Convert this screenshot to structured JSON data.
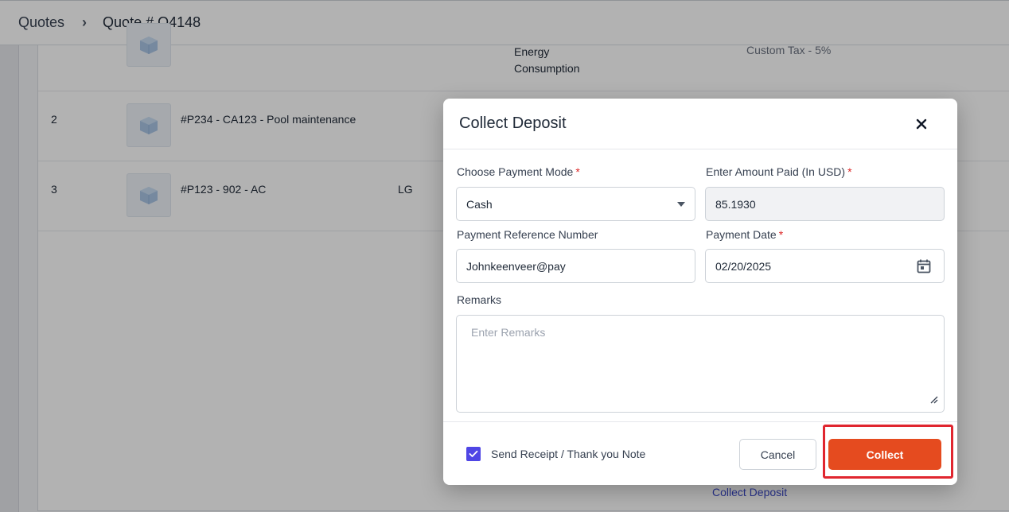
{
  "breadcrumb": {
    "parent": "Quotes",
    "separator": "›",
    "current": "Quote # Q4148"
  },
  "table": {
    "rows": [
      {
        "index": "",
        "product": "",
        "desc_line1": "Energy",
        "desc_line2": "Consumption",
        "brand": "",
        "tax": "Custom Tax - 5%"
      },
      {
        "index": "2",
        "product": "#P234 - CA123 - Pool maintenance",
        "brand": "",
        "tax": ""
      },
      {
        "index": "3",
        "product": "#P123 - 902 - AC",
        "brand": "LG",
        "tax": ""
      }
    ],
    "footer_link": "Collect Deposit"
  },
  "modal": {
    "title": "Collect Deposit",
    "payment_mode": {
      "label": "Choose Payment Mode",
      "required_mark": "*",
      "value": "Cash"
    },
    "amount_paid": {
      "label": "Enter Amount Paid (In USD)",
      "required_mark": "*",
      "value": "85.1930"
    },
    "reference": {
      "label": "Payment Reference Number",
      "value": "Johnkeenveer@pay"
    },
    "payment_date": {
      "label": "Payment Date",
      "required_mark": "*",
      "value": "02/20/2025"
    },
    "remarks": {
      "label": "Remarks",
      "placeholder": "Enter Remarks"
    },
    "send_receipt": {
      "label": "Send Receipt / Thank you Note",
      "checked": true
    },
    "cancel_label": "Cancel",
    "collect_label": "Collect"
  },
  "colors": {
    "accent": "#e54b1f",
    "checkbox": "#4f46e5",
    "required": "#dc2626",
    "highlight": "#e0262f"
  },
  "icons": [
    "chevron-right-icon",
    "product-box-icon",
    "close-icon",
    "chevron-down-icon",
    "calendar-icon",
    "resize-handle-icon",
    "checkmark-icon"
  ]
}
